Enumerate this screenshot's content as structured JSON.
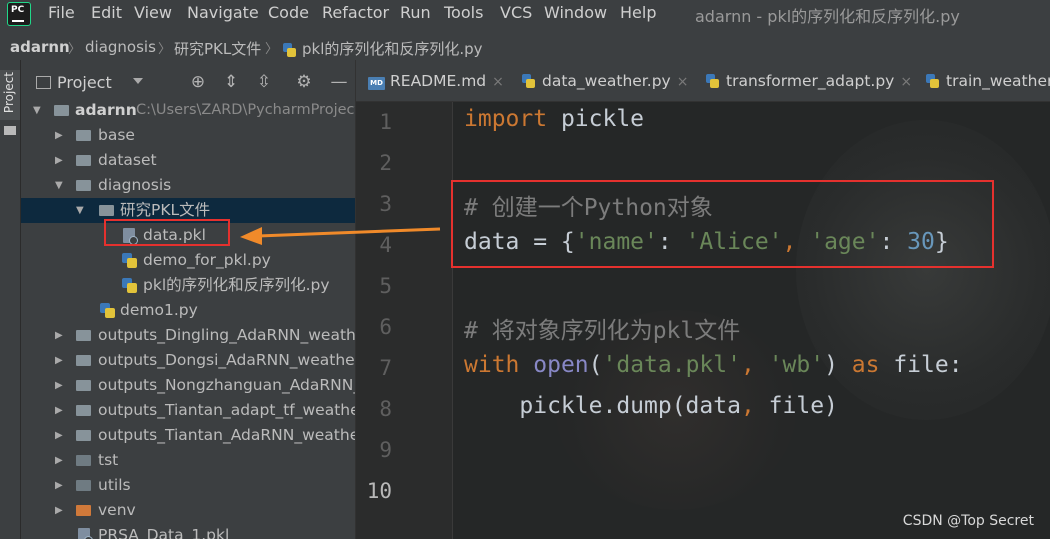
{
  "menubar": {
    "items": [
      "File",
      "Edit",
      "View",
      "Navigate",
      "Code",
      "Refactor",
      "Run",
      "Tools",
      "VCS",
      "Window",
      "Help"
    ],
    "window_title": "adarnn - pkl的序列化和反序列化.py"
  },
  "breadcrumb": [
    "adarnn",
    "diagnosis",
    "研究PKL文件",
    "pkl的序列化和反序列化.py"
  ],
  "left_stripe": {
    "project_label": "Project"
  },
  "project_panel": {
    "title": "Project",
    "tree": [
      {
        "label": "adarnn",
        "path": "C:\\Users\\ZARD\\PycharmProjects"
      },
      {
        "label": "base"
      },
      {
        "label": "dataset"
      },
      {
        "label": "diagnosis"
      },
      {
        "label": "研究PKL文件"
      },
      {
        "label": "data.pkl"
      },
      {
        "label": "demo_for_pkl.py"
      },
      {
        "label": "pkl的序列化和反序列化.py"
      },
      {
        "label": "demo1.py"
      },
      {
        "label": "outputs_Dingling_AdaRNN_weather"
      },
      {
        "label": "outputs_Dongsi_AdaRNN_weather_"
      },
      {
        "label": "outputs_Nongzhanguan_AdaRNN_w"
      },
      {
        "label": "outputs_Tiantan_adapt_tf_weather_"
      },
      {
        "label": "outputs_Tiantan_AdaRNN_weather_"
      },
      {
        "label": "tst"
      },
      {
        "label": "utils"
      },
      {
        "label": "venv"
      },
      {
        "label": "PRSA_Data_1.pkl"
      }
    ]
  },
  "editor": {
    "tabs": [
      {
        "label": "README.md"
      },
      {
        "label": "data_weather.py"
      },
      {
        "label": "transformer_adapt.py"
      },
      {
        "label": "train_weather."
      }
    ],
    "line_numbers": [
      "1",
      "2",
      "3",
      "4",
      "5",
      "6",
      "7",
      "8",
      "9",
      "10"
    ],
    "code": {
      "l1_kw": "import",
      "l1_rest": " pickle",
      "l3": "# 创建一个Python对象",
      "l4_a": "data = {",
      "l4_k1": "'name'",
      "l4_b": ": ",
      "l4_v1": "'Alice'",
      "l4_c": ", ",
      "l4_k2": "'age'",
      "l4_d": ": ",
      "l4_v2": "30",
      "l4_e": "}",
      "l6": "# 将对象序列化为pkl文件",
      "l7_kw": "with",
      "l7_sp": " ",
      "l7_fn": "open",
      "l7_a": "(",
      "l7_s1": "'data.pkl'",
      "l7_b": ", ",
      "l7_s2": "'wb'",
      "l7_c": ") ",
      "l7_as": "as",
      "l7_d": " file:",
      "l8_a": "    pickle.dump(data",
      "l8_b": ", ",
      "l8_c": "file)"
    }
  },
  "watermark": "CSDN @Top Secret",
  "colors": {
    "highlight": "#e5312e",
    "arrow": "#f08a2a",
    "keyword": "#cc7832",
    "string": "#6a8759",
    "number": "#6897bb"
  }
}
